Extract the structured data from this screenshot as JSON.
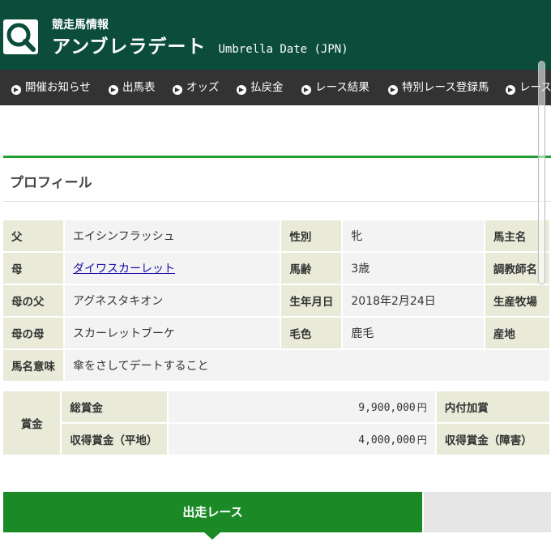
{
  "header": {
    "kicker": "競走馬情報",
    "title_ja": "アンブレラデート",
    "title_en": "Umbrella Date (JPN)",
    "logo_icon": "search-icon"
  },
  "nav": {
    "items": [
      "開催お知らせ",
      "出馬表",
      "オッズ",
      "払戻金",
      "レース結果",
      "特別レース登録馬",
      "レース"
    ]
  },
  "profile": {
    "section_title": "プロフィール",
    "rows": [
      {
        "label": "父",
        "value": "エイシンフラッシュ",
        "label2": "性別",
        "value2": "牝",
        "label3": "馬主名"
      },
      {
        "label": "母",
        "value": "ダイワスカーレット",
        "label2": "馬齢",
        "value2": "3歳",
        "label3": "調教師名"
      },
      {
        "label": "母の父",
        "value": "アグネスタキオン",
        "label2": "生年月日",
        "value2": "2018年2月24日",
        "label3": "生産牧場"
      },
      {
        "label": "母の母",
        "value": "スカーレットブーケ",
        "label2": "毛色",
        "value2": "鹿毛",
        "label3": "産地"
      },
      {
        "label": "馬名意味",
        "value": "傘をさしてデートすること"
      }
    ]
  },
  "prize": {
    "header": "賞金",
    "rows": [
      {
        "label": "総賞金",
        "amount": "9,900,000",
        "unit": "円",
        "label2": "内付加賞"
      },
      {
        "label": "収得賞金（平地）",
        "amount": "4,000,000",
        "unit": "円",
        "label2": "収得賞金（障害）"
      }
    ]
  },
  "tabs": {
    "active": "出走レース"
  },
  "colors": {
    "header_bg": "#0b4d3a",
    "nav_bg": "#333333",
    "accent_green": "#21a032",
    "tab_green": "#1b8a26"
  }
}
